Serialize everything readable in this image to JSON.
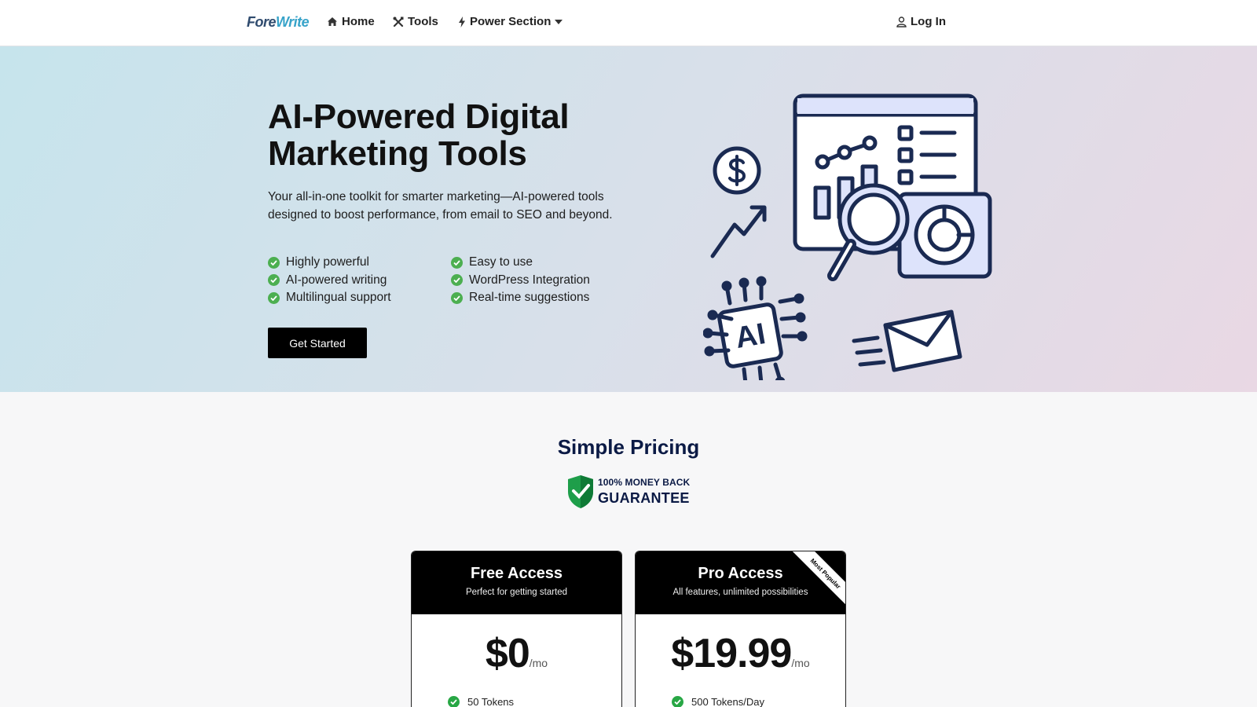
{
  "nav": {
    "logo_fore": "Fore",
    "logo_write": "Write",
    "home": "Home",
    "tools": "Tools",
    "power": "Power Section",
    "login": "Log In"
  },
  "hero": {
    "title": "AI-Powered Digital Marketing Tools",
    "description": "Your all-in-one toolkit for smarter marketing—AI-powered tools designed to boost performance, from email to SEO and beyond.",
    "features": [
      "Highly powerful",
      "Easy to use",
      "AI-powered writing",
      "WordPress Integration",
      "Multilingual support",
      "Real-time suggestions"
    ],
    "cta": "Get Started",
    "illustration_ai_label": "AI"
  },
  "pricing": {
    "title": "Simple Pricing",
    "badge_line1": "100% MONEY BACK",
    "badge_line2": "GUARANTEE",
    "plans": [
      {
        "name": "Free Access",
        "subtitle": "Perfect for getting started",
        "price": "$0",
        "period": "/mo",
        "feature": "50 Tokens"
      },
      {
        "name": "Pro Access",
        "subtitle": "All features, unlimited possibilities",
        "price": "$19.99",
        "period": "/mo",
        "feature": "500 Tokens/Day",
        "ribbon": "Most Popular"
      }
    ]
  },
  "colors": {
    "accent_green": "#4caf50",
    "navy": "#0b1a45",
    "logo_blue": "#37a3c9"
  }
}
